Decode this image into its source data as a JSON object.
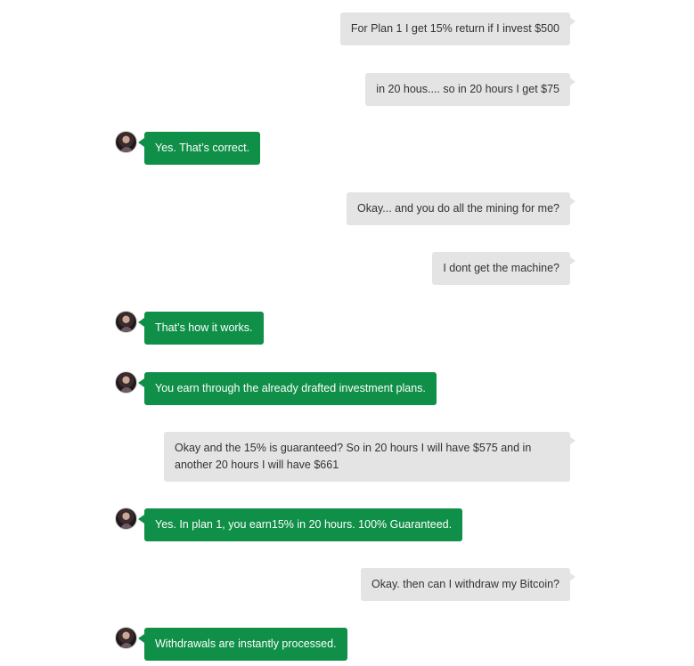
{
  "conversation": {
    "messages": [
      {
        "side": "out",
        "text": "For Plan 1 I get 15% return if I invest $500"
      },
      {
        "side": "out",
        "text": "in 20 hous.... so in 20 hours I get $75"
      },
      {
        "side": "in",
        "text": "Yes. That’s correct."
      },
      {
        "side": "out",
        "text": "Okay... and you do all the mining for me?"
      },
      {
        "side": "out",
        "text": "I dont get the machine?"
      },
      {
        "side": "in",
        "text": "That’s how it works."
      },
      {
        "side": "in",
        "text": "You earn through the already drafted investment plans."
      },
      {
        "side": "out",
        "text": "Okay and the 15% is guaranteed? So in 20 hours I will have $575 and in another 20 hours I will have $661"
      },
      {
        "side": "in",
        "text": "Yes. In plan 1, you earn15% in 20 hours. 100% Guaranteed."
      },
      {
        "side": "out",
        "text": "Okay. then can I withdraw my Bitcoin?"
      },
      {
        "side": "in",
        "text": "Withdrawals are instantly processed."
      }
    ]
  },
  "colors": {
    "outgoing_bubble": "#e4e4e4",
    "incoming_bubble": "#0f8f47",
    "incoming_text": "#ffffff",
    "outgoing_text": "#333333"
  },
  "icons": {
    "agent_avatar": "agent-avatar-icon"
  }
}
